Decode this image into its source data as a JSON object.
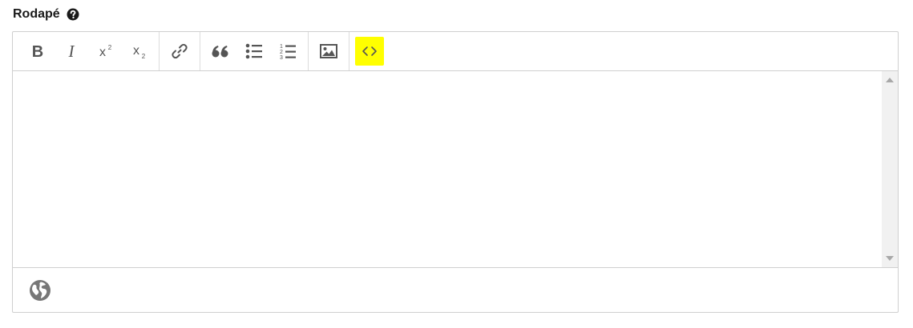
{
  "field": {
    "label": "Rodapé",
    "help_icon": "question-circle-icon"
  },
  "toolbar": {
    "groups": [
      [
        {
          "name": "bold",
          "icon": "bold-icon",
          "glyph": "B"
        },
        {
          "name": "italic",
          "icon": "italic-icon",
          "glyph": "I"
        },
        {
          "name": "superscript",
          "icon": "superscript-icon",
          "glyph": "x",
          "script": "2"
        },
        {
          "name": "subscript",
          "icon": "subscript-icon",
          "glyph": "x",
          "script": "2"
        }
      ],
      [
        {
          "name": "link",
          "icon": "link-icon"
        }
      ],
      [
        {
          "name": "blockquote",
          "icon": "quote-icon"
        },
        {
          "name": "bulleted-list",
          "icon": "bulleted-list-icon"
        },
        {
          "name": "numbered-list",
          "icon": "numbered-list-icon",
          "numbers": [
            "1",
            "2",
            "3"
          ]
        }
      ],
      [
        {
          "name": "image",
          "icon": "image-icon"
        }
      ],
      [
        {
          "name": "source",
          "icon": "code-icon",
          "active": true
        }
      ]
    ]
  },
  "editor": {
    "content": ""
  },
  "footer": {
    "icon": "globe-icon"
  },
  "colors": {
    "active_highlight": "#ffff00",
    "icon_gray": "#555555",
    "border": "#cfcfcf"
  }
}
